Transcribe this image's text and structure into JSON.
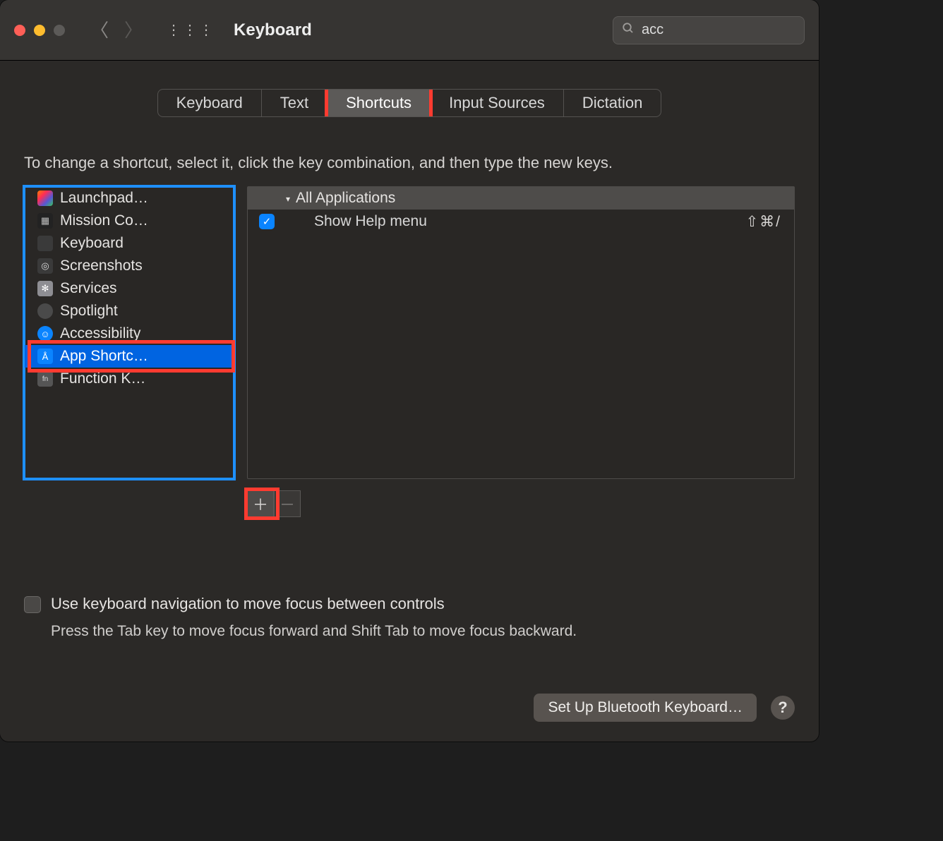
{
  "window_title": "Keyboard",
  "search_value": "acc",
  "tabs": [
    "Keyboard",
    "Text",
    "Shortcuts",
    "Input Sources",
    "Dictation"
  ],
  "active_tab_index": 2,
  "instruction": "To change a shortcut, select it, click the key combination, and then type the new keys.",
  "categories": [
    "Launchpad…",
    "Mission Co…",
    "Keyboard",
    "Screenshots",
    "Services",
    "Spotlight",
    "Accessibility",
    "App Shortc…",
    "Function K…"
  ],
  "selected_category_index": 7,
  "group_label": "All Applications",
  "rows": [
    {
      "enabled": true,
      "label": "Show Help menu",
      "keys": "⇧⌘/"
    }
  ],
  "checkbox_label": "Use keyboard navigation to move focus between controls",
  "checkbox_desc": "Press the Tab key to move focus forward and Shift Tab to move focus backward.",
  "bt_button": "Set Up Bluetooth Keyboard…"
}
